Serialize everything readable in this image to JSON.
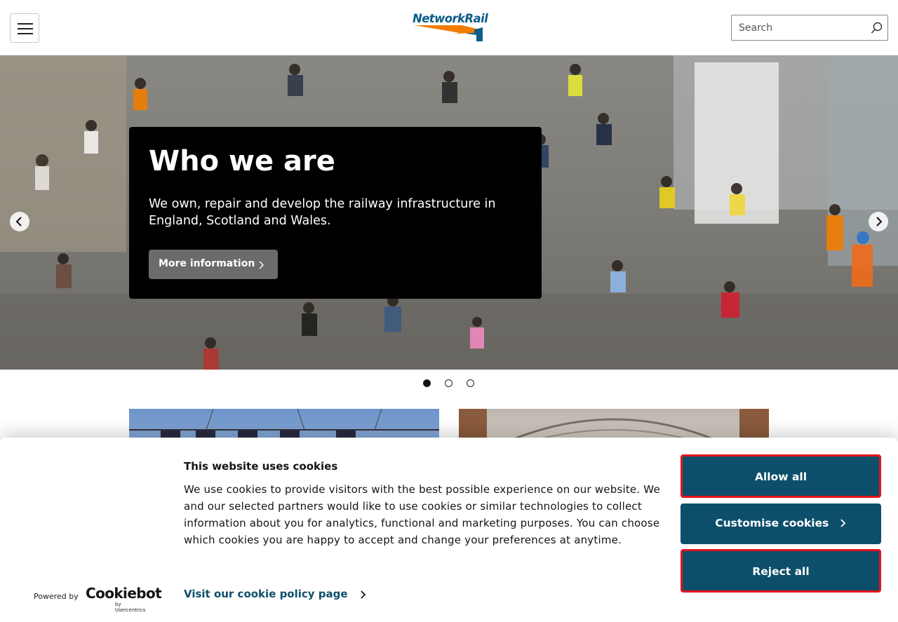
{
  "header": {
    "menu_icon": "hamburger-menu-icon",
    "logo_text": "NetworkRail",
    "brand_colors": {
      "blue": "#0d5c8a",
      "orange": "#f07d00"
    },
    "search": {
      "placeholder": "Search",
      "icon": "magnifier-icon"
    }
  },
  "hero": {
    "title": "Who we are",
    "text": "We own, repair and develop the railway infrastructure in England, Scotland and Wales.",
    "button_label": "More information",
    "prev_icon": "chevron-left-icon",
    "next_icon": "chevron-right-icon",
    "slides_total": 3,
    "active_slide": 1
  },
  "cookie_banner": {
    "title": "This website uses cookies",
    "body": "We use cookies to provide visitors with the best possible experience on our website. We and our selected partners would like to use cookies or similar technologies to collect information about you for analytics, functional and marketing purposes. You can choose which cookies you are happy to accept and change your preferences at anytime.",
    "policy_link": "Visit our cookie policy page",
    "allow_all": "Allow all",
    "customise": "Customise cookies",
    "reject_all": "Reject all",
    "powered_by": "Powered by",
    "provider": "Cookiebot",
    "provider_sub": "by Usercentrics",
    "accent_color": "#0d4f6b"
  }
}
